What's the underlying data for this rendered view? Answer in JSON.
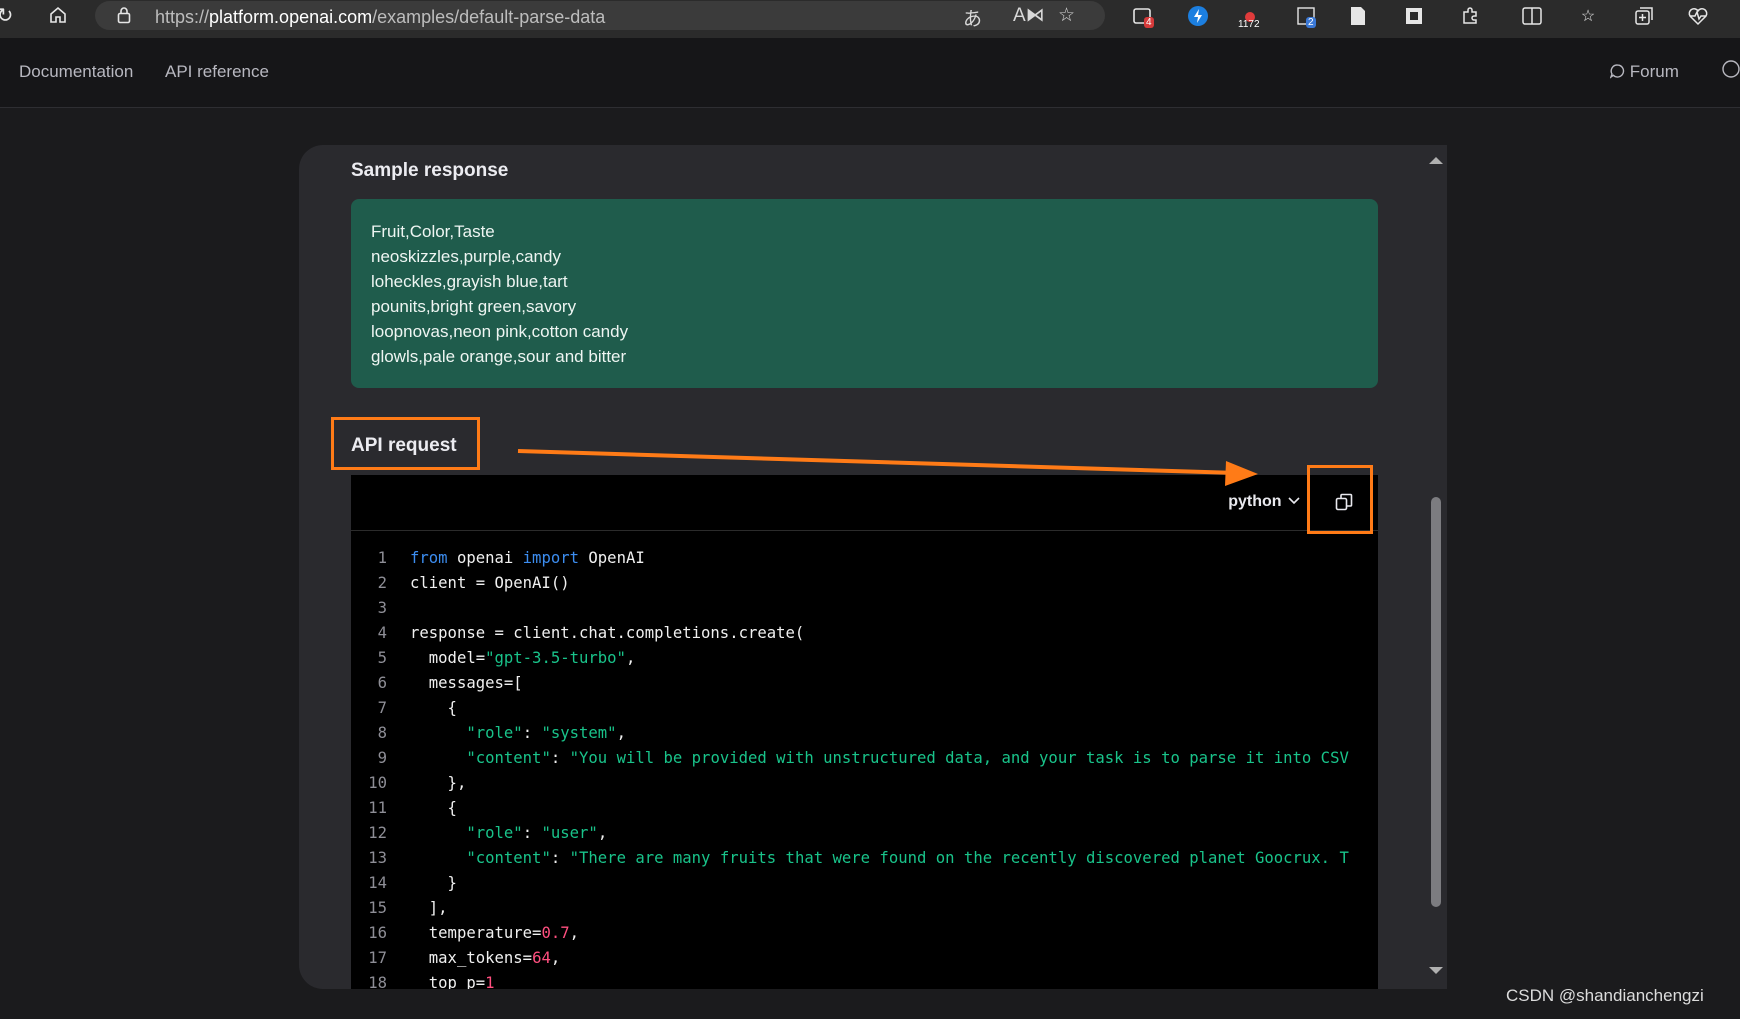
{
  "browser": {
    "url_prefix": "https://",
    "url_host": "platform.openai.com",
    "url_path": "/examples/default-parse-data",
    "extensions": [
      {
        "name": "ext-1",
        "badge": "4",
        "badge_color": "#d63a3a"
      },
      {
        "name": "ext-2",
        "badge": "",
        "badge_color": ""
      },
      {
        "name": "ext-3",
        "badge": "1172",
        "badge_color": ""
      },
      {
        "name": "ext-4",
        "badge": "2",
        "badge_color": "#3a78d6"
      }
    ]
  },
  "nav": {
    "documentation": "Documentation",
    "api_reference": "API reference",
    "forum": "Forum"
  },
  "main": {
    "sample_response_title": "Sample response",
    "sample_response_lines": [
      "Fruit,Color,Taste",
      "neoskizzles,purple,candy",
      "loheckles,grayish blue,tart",
      "pounits,bright green,savory",
      "loopnovas,neon pink,cotton candy",
      "glowls,pale orange,sour and bitter"
    ],
    "api_request_title": "API request",
    "language": "python",
    "code_lines": [
      [
        [
          "kw",
          "from"
        ],
        [
          "p",
          " openai "
        ],
        [
          "kw",
          "import"
        ],
        [
          "p",
          " OpenAI"
        ]
      ],
      [
        [
          "p",
          "client = OpenAI()"
        ]
      ],
      [
        [
          "p",
          ""
        ]
      ],
      [
        [
          "p",
          "response = client.chat.completions.create("
        ]
      ],
      [
        [
          "p",
          "  model="
        ],
        [
          "str",
          "\"gpt-3.5-turbo\""
        ],
        [
          "p",
          ","
        ]
      ],
      [
        [
          "p",
          "  messages=["
        ]
      ],
      [
        [
          "p",
          "    {"
        ]
      ],
      [
        [
          "p",
          "      "
        ],
        [
          "str",
          "\"role\""
        ],
        [
          "p",
          ": "
        ],
        [
          "str",
          "\"system\""
        ],
        [
          "p",
          ","
        ]
      ],
      [
        [
          "p",
          "      "
        ],
        [
          "str",
          "\"content\""
        ],
        [
          "p",
          ": "
        ],
        [
          "str",
          "\"You will be provided with unstructured data, and your task is to parse it into CSV"
        ]
      ],
      [
        [
          "p",
          "    },"
        ]
      ],
      [
        [
          "p",
          "    {"
        ]
      ],
      [
        [
          "p",
          "      "
        ],
        [
          "str",
          "\"role\""
        ],
        [
          "p",
          ": "
        ],
        [
          "str",
          "\"user\""
        ],
        [
          "p",
          ","
        ]
      ],
      [
        [
          "p",
          "      "
        ],
        [
          "str",
          "\"content\""
        ],
        [
          "p",
          ": "
        ],
        [
          "str",
          "\"There are many fruits that were found on the recently discovered planet Goocrux. T"
        ]
      ],
      [
        [
          "p",
          "    }"
        ]
      ],
      [
        [
          "p",
          "  ],"
        ]
      ],
      [
        [
          "p",
          "  temperature="
        ],
        [
          "num",
          "0.7"
        ],
        [
          "p",
          ","
        ]
      ],
      [
        [
          "p",
          "  max_tokens="
        ],
        [
          "num",
          "64"
        ],
        [
          "p",
          ","
        ]
      ],
      [
        [
          "p",
          "  top_p="
        ],
        [
          "num",
          "1"
        ]
      ]
    ]
  },
  "annotation_color": "#ff7b17",
  "watermark": "CSDN @shandianchengzi"
}
